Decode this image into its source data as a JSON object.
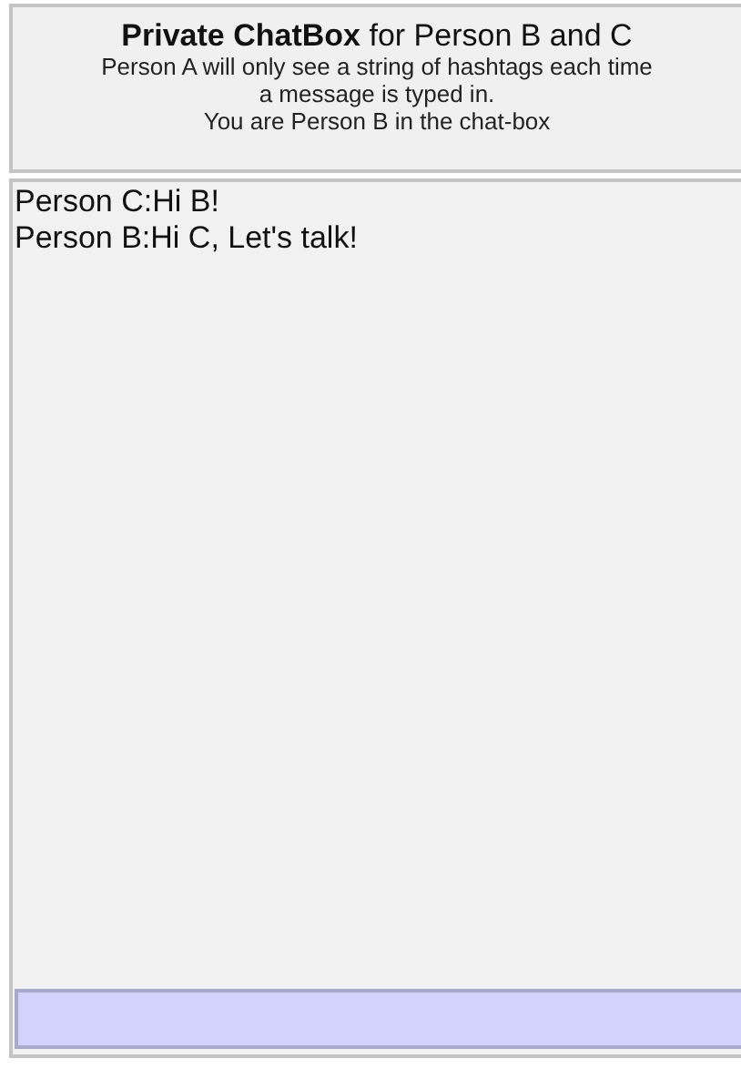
{
  "header": {
    "title": "**Private ChatBox** for Person B and C",
    "lines": [
      "Person A will only see a string of hashtags each time",
      "a message is typed in.",
      "You are Person B in the chat-box"
    ]
  },
  "messages": [
    {
      "text": "Person C:Hi B!"
    },
    {
      "text": "Person B:Hi C, Let's talk!"
    }
  ]
}
